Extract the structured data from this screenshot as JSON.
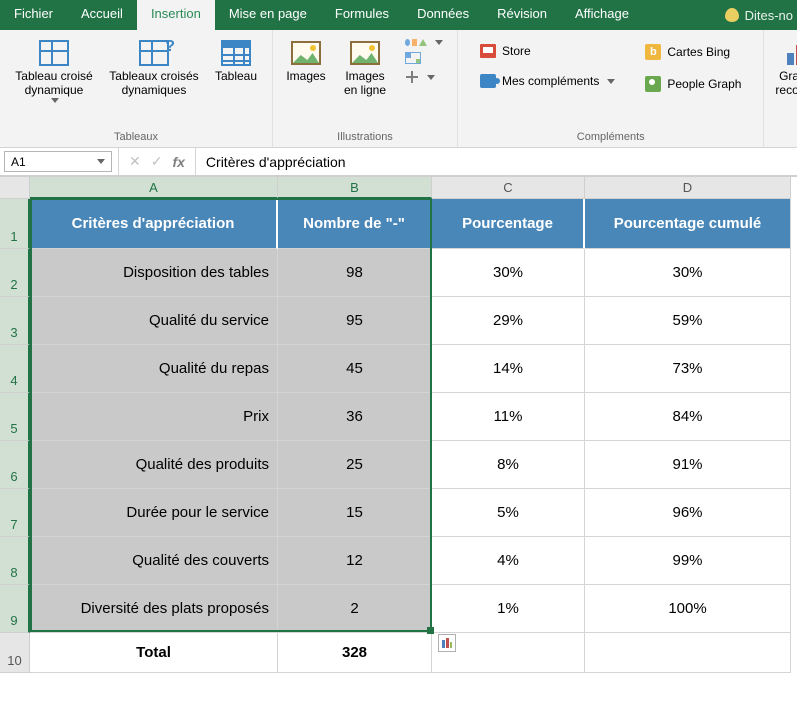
{
  "titlebar": {
    "file": "Fichier",
    "tabs": [
      "Accueil",
      "Insertion",
      "Mise en page",
      "Formules",
      "Données",
      "Révision",
      "Affichage"
    ],
    "active_index": 1,
    "tell_me": "Dites-no"
  },
  "ribbon": {
    "groups": {
      "tables": {
        "label": "Tableaux",
        "pivot": "Tableau croisé\ndynamique",
        "pivots": "Tableaux croisés\ndynamiques",
        "table": "Tableau"
      },
      "illustrations": {
        "label": "Illustrations",
        "images": "Images",
        "images_online": "Images\nen ligne"
      },
      "addins": {
        "label": "Compléments",
        "store": "Store",
        "my": "Mes compléments",
        "bing": "Cartes Bing",
        "people": "People Graph"
      },
      "charts": {
        "label": "",
        "recommended": "Graphiq\nrecomma"
      }
    }
  },
  "namebox": "A1",
  "formula_bar": "Critères d'appréciation",
  "columns": [
    "A",
    "B",
    "C",
    "D"
  ],
  "headers": {
    "crit": "Critères d'appréciation",
    "nb": "Nombre de \"-\"",
    "pct": "Pourcentage",
    "pctcum": "Pourcentage cumulé"
  },
  "rows": [
    {
      "crit": "Disposition des tables",
      "nb": "98",
      "pct": "30%",
      "pctcum": "30%"
    },
    {
      "crit": "Qualité du service",
      "nb": "95",
      "pct": "29%",
      "pctcum": "59%"
    },
    {
      "crit": "Qualité du repas",
      "nb": "45",
      "pct": "14%",
      "pctcum": "73%"
    },
    {
      "crit": "Prix",
      "nb": "36",
      "pct": "11%",
      "pctcum": "84%"
    },
    {
      "crit": "Qualité des produits",
      "nb": "25",
      "pct": "8%",
      "pctcum": "91%"
    },
    {
      "crit": "Durée pour le service",
      "nb": "15",
      "pct": "5%",
      "pctcum": "96%"
    },
    {
      "crit": "Qualité des couverts",
      "nb": "12",
      "pct": "4%",
      "pctcum": "99%"
    },
    {
      "crit": "Diversité des plats proposés",
      "nb": "2",
      "pct": "1%",
      "pctcum": "100%"
    }
  ],
  "total": {
    "label": "Total",
    "value": "328"
  },
  "chart_data": {
    "type": "table",
    "title": "Critères d'appréciation",
    "columns": [
      "Critères d'appréciation",
      "Nombre de \"-\"",
      "Pourcentage",
      "Pourcentage cumulé"
    ],
    "series": [
      {
        "name": "Nombre de \"-\"",
        "categories": [
          "Disposition des tables",
          "Qualité du service",
          "Qualité du repas",
          "Prix",
          "Qualité des produits",
          "Durée pour le service",
          "Qualité des couverts",
          "Diversité des plats proposés"
        ],
        "values": [
          98,
          95,
          45,
          36,
          25,
          15,
          12,
          2
        ]
      },
      {
        "name": "Pourcentage",
        "values": [
          30,
          29,
          14,
          11,
          8,
          5,
          4,
          1
        ],
        "unit": "%"
      },
      {
        "name": "Pourcentage cumulé",
        "values": [
          30,
          59,
          73,
          84,
          91,
          96,
          99,
          100
        ],
        "unit": "%"
      }
    ],
    "total": 328
  }
}
